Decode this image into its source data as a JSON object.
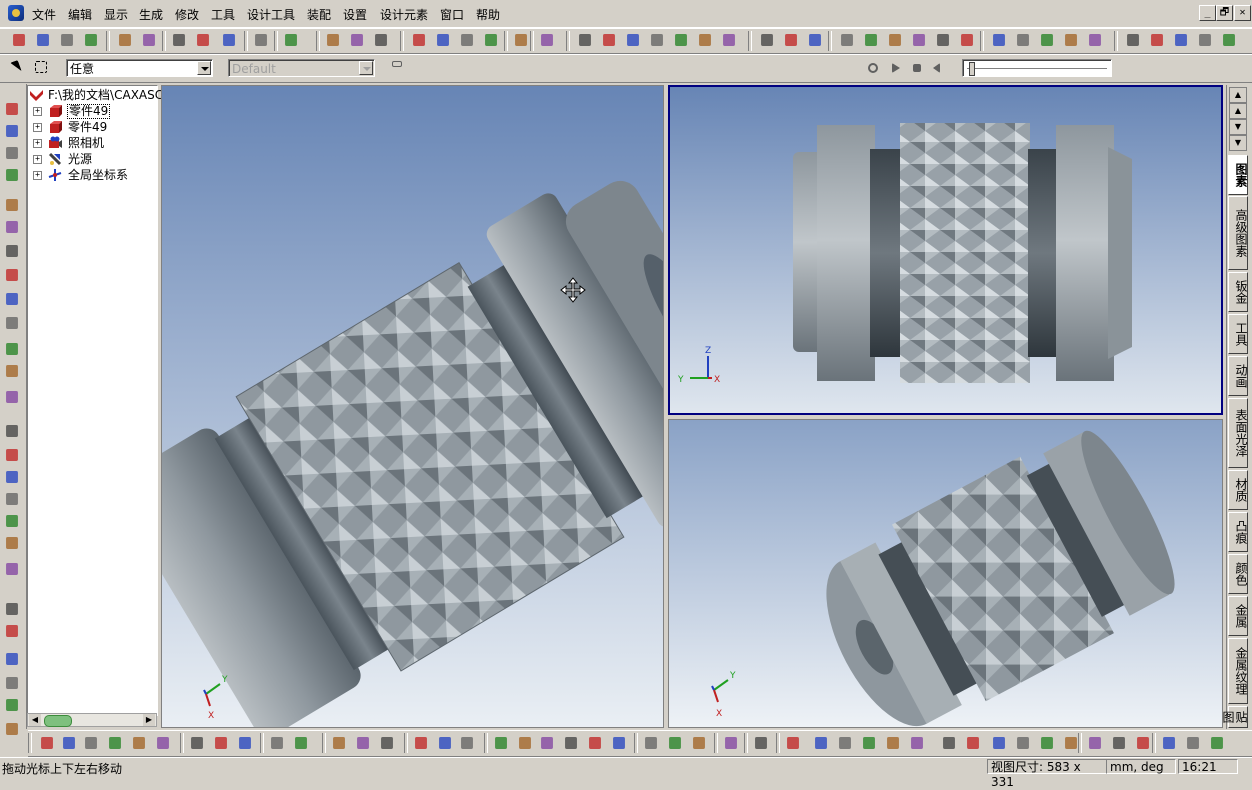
{
  "menu": {
    "items": [
      "文件",
      "编辑",
      "显示",
      "生成",
      "修改",
      "工具",
      "设计工具",
      "装配",
      "设置",
      "设计元素",
      "窗口",
      "帮助"
    ],
    "window_buttons": [
      "_",
      "🗗",
      "✕"
    ]
  },
  "toolbar2": {
    "filter_combo": "任意",
    "style_combo": "Default"
  },
  "tree": {
    "root": "F:\\我的文档\\CAXASC",
    "items": [
      "零件49",
      "零件49",
      "照相机",
      "光源",
      "全局坐标系"
    ]
  },
  "right_tabs": [
    "图素",
    "高级图素",
    "钣金",
    "工具",
    "动画",
    "表面光泽",
    "材质",
    "凸痕",
    "颜色",
    "金属",
    "金属纹理",
    "贴图"
  ],
  "axes": {
    "x": "X",
    "y": "Y",
    "z": "Z"
  },
  "status": {
    "message": "拖动光标上下左右移动",
    "view_size_label": "视图尺寸:",
    "view_size": "583 x 331",
    "units": "mm, deg",
    "time": "16:21"
  },
  "colors": {
    "face": "#d4d0c8",
    "viewport_top": "#6785b5",
    "viewport_bottom": "#e8eef4",
    "active_border": "#000080",
    "part_metal": "#8e979e"
  }
}
